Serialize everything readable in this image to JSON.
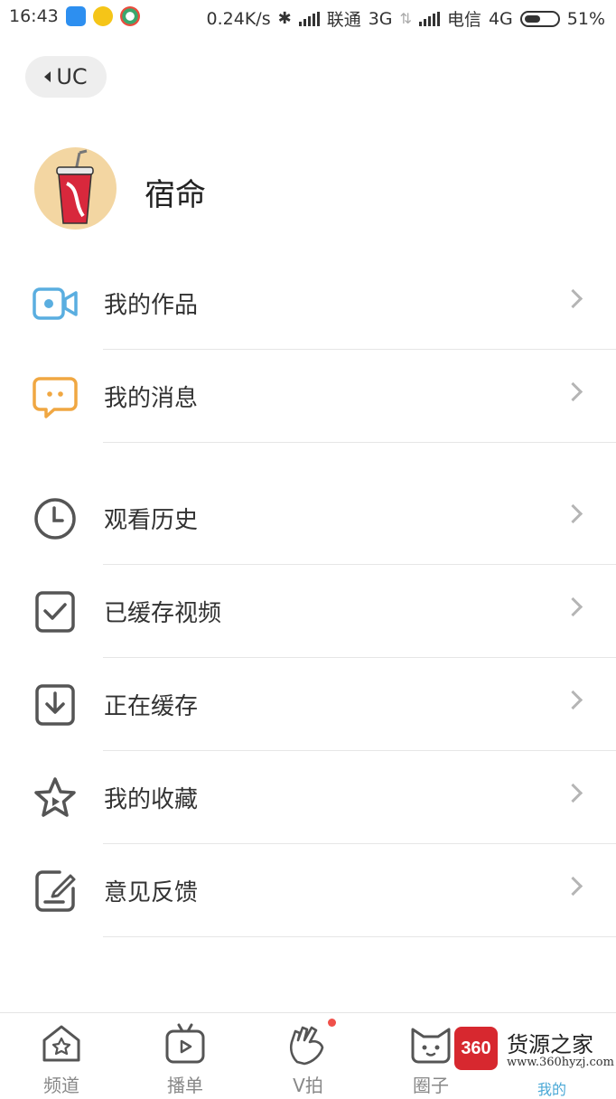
{
  "status_bar": {
    "time": "16:43",
    "speed": "0.24K/s",
    "carrier1": "联通",
    "net1": "3G",
    "carrier2": "电信",
    "net2": "4G",
    "battery": "51%",
    "battery_level": 0.51
  },
  "back": {
    "label": "UC"
  },
  "profile": {
    "name": "宿命",
    "avatar_text": "coke"
  },
  "menu": [
    {
      "label": "我的作品",
      "icon": "video-camera-icon",
      "color": "#5aaee0"
    },
    {
      "label": "我的消息",
      "icon": "message-bubble-icon",
      "color": "#f0a742"
    },
    {
      "label": "观看历史",
      "icon": "clock-icon",
      "color": "#555555"
    },
    {
      "label": "已缓存视频",
      "icon": "checkbox-icon",
      "color": "#555555"
    },
    {
      "label": "正在缓存",
      "icon": "download-icon",
      "color": "#555555"
    },
    {
      "label": "我的收藏",
      "icon": "star-icon",
      "color": "#555555"
    },
    {
      "label": "意见反馈",
      "icon": "feedback-icon",
      "color": "#555555"
    }
  ],
  "bottom_nav": [
    {
      "label": "频道",
      "icon": "home-star-icon"
    },
    {
      "label": "播单",
      "icon": "tv-play-icon"
    },
    {
      "label": "V拍",
      "icon": "hand-gesture-icon",
      "badge": true
    },
    {
      "label": "圈子",
      "icon": "cat-face-icon"
    },
    {
      "label": "我的",
      "icon": "profile-icon"
    }
  ],
  "watermark": {
    "badge": "360",
    "title": "货源之家",
    "url": "www.360hyzj.com"
  }
}
